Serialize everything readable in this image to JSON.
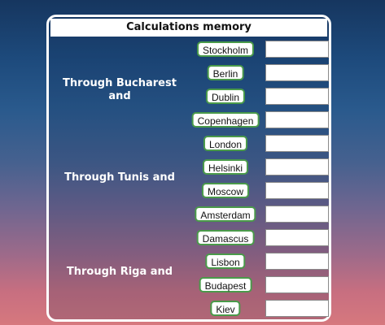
{
  "memory": {
    "title": "Calculations memory",
    "groups": [
      {
        "label": "Through Bucharest and",
        "cities": [
          "Stockholm",
          "Berlin",
          "Dublin",
          "Copenhagen"
        ]
      },
      {
        "label": "Through Tunis and",
        "cities": [
          "London",
          "Helsinki",
          "Moscow",
          "Amsterdam"
        ]
      },
      {
        "label": "Through Riga and",
        "cities": [
          "Damascus",
          "Lisbon",
          "Budapest",
          "Kiev"
        ]
      }
    ],
    "values": [
      "",
      "",
      "",
      "",
      "",
      "",
      "",
      "",
      "",
      "",
      "",
      ""
    ]
  }
}
